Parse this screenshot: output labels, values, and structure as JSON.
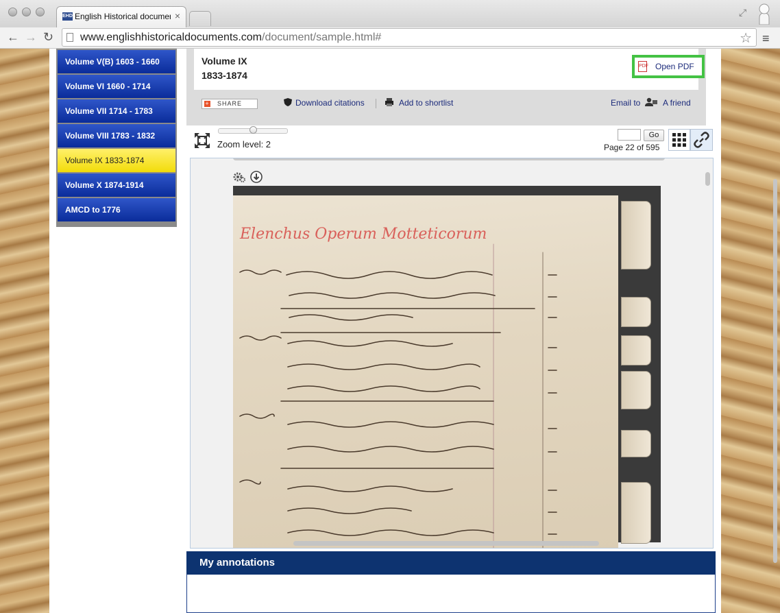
{
  "browser": {
    "tab_title": "English Historical documen",
    "tab_close": "×",
    "favicon_text": "EHD",
    "url_host": "www.englishhistoricaldocuments.com",
    "url_path": "/document/sample.html#"
  },
  "sidebar": {
    "items": [
      {
        "label": "Volume V(B) 1603 - 1660",
        "active": false
      },
      {
        "label": "Volume VI 1660 - 1714",
        "active": false
      },
      {
        "label": "Volume VII 1714 - 1783",
        "active": false
      },
      {
        "label": "Volume VIII 1783 - 1832",
        "active": false
      },
      {
        "label": "Volume IX 1833-1874",
        "active": true
      },
      {
        "label": "Volume X 1874-1914",
        "active": false
      },
      {
        "label": "AMCD to 1776",
        "active": false
      }
    ]
  },
  "document": {
    "volume": "Volume IX",
    "years": "1833-1874",
    "open_pdf_label": "Open PDF",
    "pdf_icon_text": "PDF"
  },
  "actions": {
    "share_label": "SHARE",
    "download_citations": "Download citations",
    "add_to_shortlist": "Add to shortlist",
    "email_to": "Email to",
    "a_friend": "A friend"
  },
  "viewer": {
    "zoom_label": "Zoom level: 2",
    "zoom_level_fraction": 0.5,
    "page_input_value": "",
    "go_label": "Go",
    "page_status": "Page 22 of 595",
    "manuscript_heading": "Elenchus Operum Motteticorum"
  },
  "annotations": {
    "title": "My annotations"
  },
  "icons": {
    "expand": "expand-icon",
    "gear": "gear-icon",
    "download": "download-icon",
    "grid": "grid-icon",
    "link": "link-icon",
    "pdf": "pdf-icon",
    "shield": "shield-icon",
    "printer": "printer-icon",
    "person": "person-icon"
  },
  "colors": {
    "volume_blue": "#0a2c9a",
    "active_yellow": "#f2dc0a",
    "pdf_highlight": "#44c244",
    "annotations_header": "#0d3370"
  }
}
